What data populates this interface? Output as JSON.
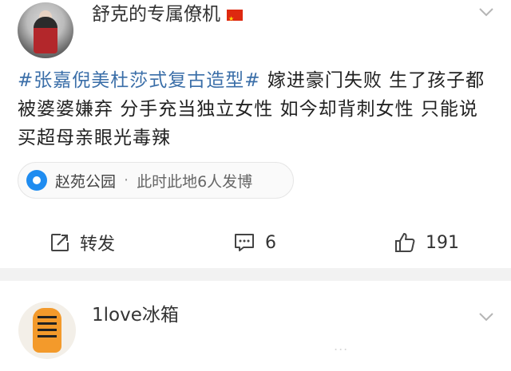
{
  "post": {
    "username": "舒克的专属僚机",
    "hashtag": "#张嘉倪美杜莎式复古造型#",
    "text": " 嫁进豪门失败 生了孩子都被婆婆嫌弃 分手充当独立女性 如今却背刺女性 只能说买超母亲眼光毒辣",
    "location": {
      "name": "赵苑公园",
      "separator": "·",
      "extra": "此时此地6人发博"
    },
    "actions": {
      "repost_label": "转发",
      "comment_count": "6",
      "like_count": "191"
    }
  },
  "comment": {
    "username": "1love冰箱",
    "faded_text": "..."
  },
  "colors": {
    "hashtag": "#3a6ea8",
    "pin": "#1f8cf0",
    "divider": "#f2f2f2"
  },
  "icons": [
    "avatar",
    "flag-cn-icon",
    "chevron-down-icon",
    "location-pin-icon",
    "repost-icon",
    "comment-icon",
    "like-icon"
  ]
}
